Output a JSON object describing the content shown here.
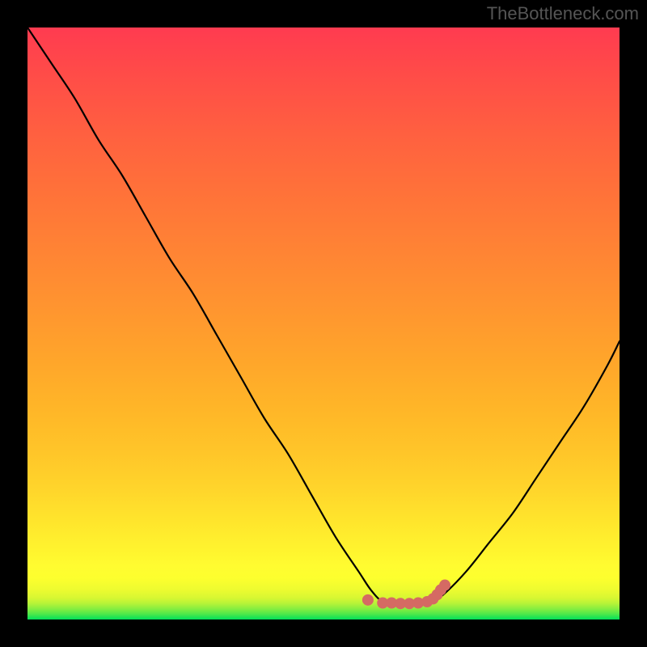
{
  "watermark": "TheBottleneck.com",
  "chart_data": {
    "type": "line",
    "title": "",
    "xlabel": "",
    "ylabel": "",
    "xlim": [
      0,
      100
    ],
    "ylim": [
      0,
      100
    ],
    "series": [
      {
        "name": "curve",
        "x": [
          0,
          4,
          8,
          12,
          16,
          20,
          24,
          28,
          32,
          36,
          40,
          44,
          48,
          52,
          56,
          58,
          60,
          62,
          64,
          66,
          68,
          70,
          74,
          78,
          82,
          86,
          90,
          94,
          98,
          100
        ],
        "y": [
          100,
          94,
          88,
          81,
          75,
          68,
          61,
          55,
          48,
          41,
          34,
          28,
          21,
          14,
          8,
          5,
          3,
          3,
          2.8,
          2.8,
          3,
          4,
          8,
          13,
          18,
          24,
          30,
          36,
          43,
          47
        ]
      }
    ],
    "markers": {
      "name": "highlight",
      "color": "#d56a63",
      "x": [
        57.5,
        60,
        61.5,
        63,
        64.5,
        66,
        67.5,
        68.5,
        69.2,
        69.8,
        70.5
      ],
      "y": [
        3.3,
        2.8,
        2.8,
        2.7,
        2.7,
        2.8,
        3.0,
        3.5,
        4.2,
        5.0,
        5.8
      ]
    },
    "gradient_stops": [
      {
        "pos": 0.0,
        "color": "#00e05a"
      },
      {
        "pos": 0.03,
        "color": "#b6f338"
      },
      {
        "pos": 0.07,
        "color": "#fdff2e"
      },
      {
        "pos": 0.17,
        "color": "#ffe42c"
      },
      {
        "pos": 0.35,
        "color": "#ffb728"
      },
      {
        "pos": 0.62,
        "color": "#ff8434"
      },
      {
        "pos": 0.82,
        "color": "#ff6040"
      },
      {
        "pos": 1.0,
        "color": "#ff3b50"
      }
    ]
  }
}
